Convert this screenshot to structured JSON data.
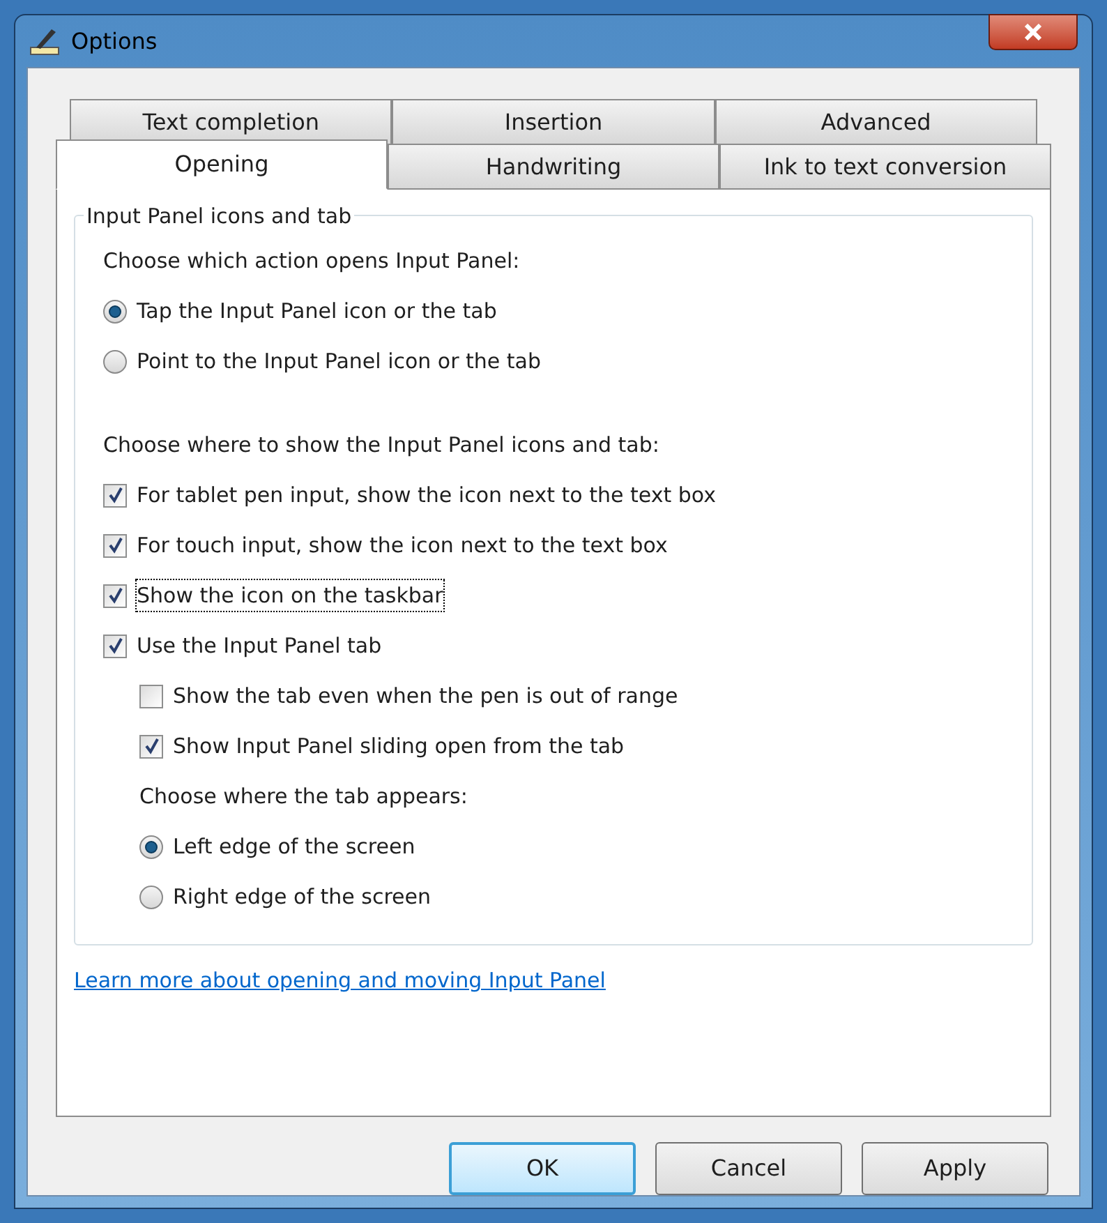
{
  "window": {
    "title": "Options"
  },
  "tabs": {
    "rows": [
      [
        {
          "label": "Text completion",
          "selected": false
        },
        {
          "label": "Insertion",
          "selected": false
        },
        {
          "label": "Advanced",
          "selected": false
        }
      ],
      [
        {
          "label": "Opening",
          "selected": true
        },
        {
          "label": "Handwriting",
          "selected": false
        },
        {
          "label": "Ink to text conversion",
          "selected": false
        }
      ]
    ]
  },
  "group": {
    "title": "Input Panel icons and tab",
    "items": [
      {
        "kind": "heading",
        "label": "Choose which action opens Input Panel:"
      },
      {
        "kind": "radio",
        "label": "Tap the Input Panel icon or the tab",
        "selected": true,
        "focused": false
      },
      {
        "kind": "radio",
        "label": "Point to the Input Panel icon or the tab",
        "selected": false,
        "focused": false
      },
      {
        "kind": "heading",
        "label": "Choose where to show the Input Panel icons and tab:"
      },
      {
        "kind": "checkbox",
        "label": "For tablet pen input, show the icon next to the text box",
        "checked": true,
        "focused": false
      },
      {
        "kind": "checkbox",
        "label": "For touch input, show the icon next to the text box",
        "checked": true,
        "focused": false
      },
      {
        "kind": "checkbox",
        "label": "Show the icon on the taskbar",
        "checked": true,
        "focused": true
      },
      {
        "kind": "checkbox",
        "label": "Use the Input Panel tab",
        "checked": true,
        "focused": false,
        "children": [
          {
            "kind": "checkbox",
            "label": "Show the tab even when the pen is out of range",
            "checked": false,
            "focused": false
          },
          {
            "kind": "checkbox",
            "label": "Show Input Panel sliding open from the tab",
            "checked": true,
            "focused": false
          },
          {
            "kind": "heading",
            "label": "Choose where the tab appears:"
          },
          {
            "kind": "radio",
            "label": "Left edge of the screen",
            "selected": true,
            "focused": false
          },
          {
            "kind": "radio",
            "label": "Right edge of the screen",
            "selected": false,
            "focused": false
          }
        ]
      }
    ]
  },
  "link": "Learn more about opening and moving Input Panel",
  "buttons": [
    {
      "label": "OK",
      "default": true
    },
    {
      "label": "Cancel",
      "default": false
    },
    {
      "label": "Apply",
      "default": false
    }
  ]
}
